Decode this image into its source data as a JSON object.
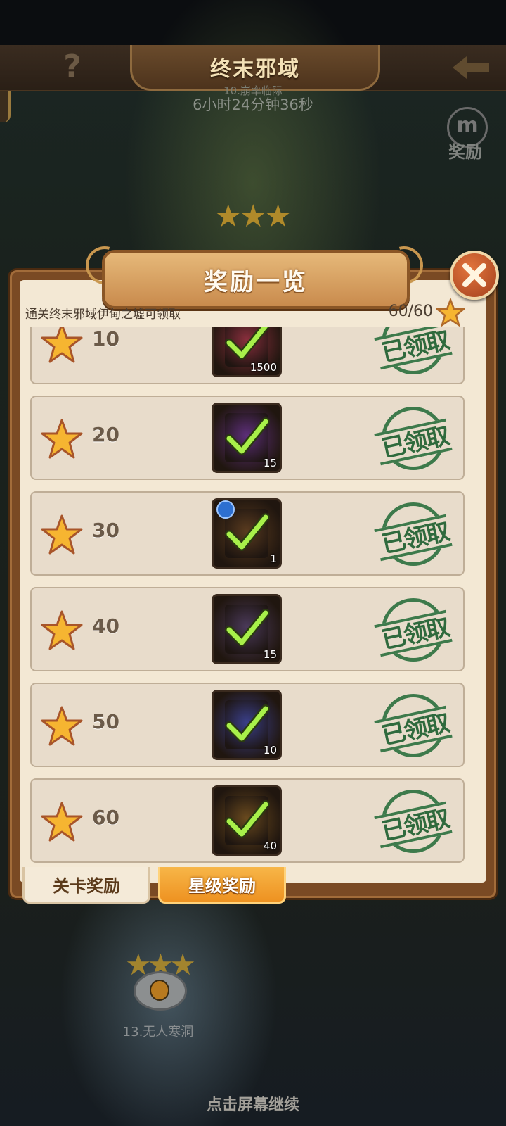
{
  "header": {
    "title": "终末邪域",
    "timer_label_partial": "10.崩率临际",
    "timer": "6小时24分钟36秒",
    "side_reward_label": "奖励"
  },
  "panel": {
    "title": "奖励一览",
    "requirement": "通关终末邪域伊甸之墟可领取",
    "progress": "60/60"
  },
  "rewards": [
    {
      "stars": "10",
      "qty": "1500",
      "status": "已领取",
      "icon": "gem-crate-icon",
      "color": "#8a2f3d"
    },
    {
      "stars": "20",
      "qty": "15",
      "status": "已领取",
      "icon": "scroll-icon",
      "color": "#5d2f7a"
    },
    {
      "stars": "30",
      "qty": "1",
      "status": "已领取",
      "icon": "card-icon",
      "color": "#5a3b1f"
    },
    {
      "stars": "40",
      "qty": "15",
      "status": "已领取",
      "icon": "orbit-relic-icon",
      "color": "#4b3a5a"
    },
    {
      "stars": "50",
      "qty": "10",
      "status": "已领取",
      "icon": "crystal-card-icon",
      "color": "#3a3f8a"
    },
    {
      "stars": "60",
      "qty": "40",
      "status": "已领取",
      "icon": "treasure-box-icon",
      "color": "#6a4a1e"
    }
  ],
  "tabs": {
    "level_rewards": "关卡奖励",
    "star_rewards": "星级奖励",
    "active": "star_rewards"
  },
  "stage": {
    "label": "13.无人寒洞"
  },
  "hint": "点击屏幕继续",
  "colors": {
    "accent_orange": "#ee9221",
    "stamp_green": "#3d7a4b",
    "star_gold": "#f6b531",
    "panel_bg": "#f3e8d4"
  }
}
